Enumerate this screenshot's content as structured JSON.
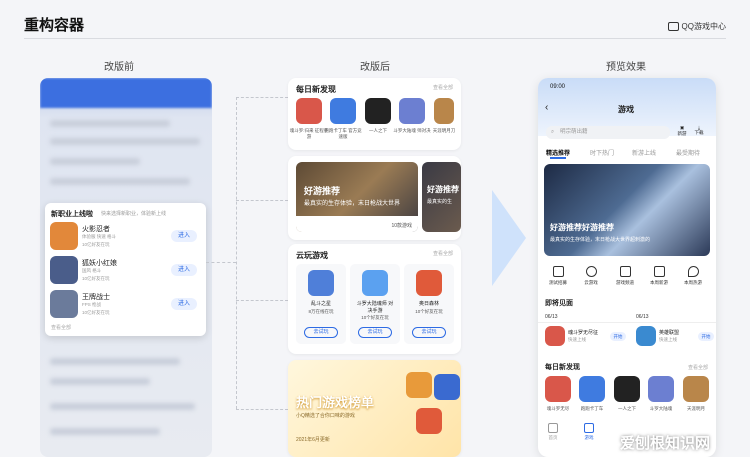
{
  "header": {
    "title": "重构容器",
    "brand": "QQ游戏中心"
  },
  "sections": {
    "before": "改版前",
    "after": "改版后",
    "preview": "预览效果"
  },
  "before_card": {
    "title": "新职业上线啦",
    "subtitle": "快来选择新职业，体验新上线",
    "items": [
      {
        "name": "火影忍者",
        "meta": "体验服 快速 格斗",
        "meta2": "10亿好友在玩",
        "action": "进入",
        "color": "#e2883a"
      },
      {
        "name": "狐妖小红娘",
        "meta": "国风 格斗",
        "meta2": "10亿好友在玩",
        "action": "进入",
        "color": "#4a5d8a"
      },
      {
        "name": "王牌战士",
        "meta": "FPS 枪战",
        "meta2": "10亿好友在玩",
        "action": "进入",
        "color": "#6b7b9b"
      }
    ],
    "more": "查看全部"
  },
  "daily": {
    "title": "每日新发现",
    "more": "查看全部",
    "games": [
      {
        "label": "魂斗罗:归来 征程手游",
        "color": "#d9574a"
      },
      {
        "label": "跑跑卡丁车 官方竞速版",
        "color": "#3f7be0"
      },
      {
        "label": "一人之下",
        "color": "#222"
      },
      {
        "label": "斗罗大陆魂 师对决",
        "color": "#6c7fd1"
      },
      {
        "label": "天涯明月刀",
        "color": "#b9864a"
      }
    ]
  },
  "banner": {
    "title": "好游推荐",
    "subtitle": "最真实的生存体验，末日枪战大世界",
    "count": "10款游戏",
    "title2": "好游推荐",
    "sub2": "最真实的生"
  },
  "cloud": {
    "title": "云玩游戏",
    "more": "查看全部",
    "games": [
      {
        "name": "乱斗之星",
        "players": "8万在线在玩",
        "action": "去试玩",
        "color": "#4f7fd9"
      },
      {
        "name": "斗罗大陆魂师 对决手游",
        "players": "10个好友在玩",
        "action": "去试玩",
        "color": "#5ba1f0"
      },
      {
        "name": "奥日森林",
        "players": "10个好友在玩",
        "action": "去试玩",
        "color": "#e05a3a"
      }
    ]
  },
  "rank": {
    "title": "热门游戏榜单",
    "subtitle": "小Q精选了合你口味的游戏",
    "date": "2021年6月更新"
  },
  "phone": {
    "time": "09:00",
    "header": "游戏",
    "search_placeholder": "明宗萌出籍",
    "gift": "新游",
    "download": "下载",
    "tabs": [
      "精选推荐",
      "时下热门",
      "新游上线",
      "最受期待"
    ],
    "banner_title": "好游推荐好游推荐",
    "banner_sub": "最真实的生存体验，末日枪战大世界超刺激的",
    "quick": [
      "测试招募",
      "云游戏",
      "游戏频道",
      "本周新游",
      "本周热游"
    ],
    "upcoming": {
      "title": "即将见面",
      "items": [
        {
          "date": "06/13",
          "name": "魂斗罗无尽征",
          "meta": "快速上线",
          "action": "开始"
        },
        {
          "date": "06/13",
          "name": "英雄联盟",
          "meta": "快速上线",
          "action": "开始"
        }
      ]
    },
    "daily_title": "每日新发现",
    "daily_more": "查看全部",
    "daily": [
      "魂斗罗无尽",
      "跑跑卡丁车",
      "一人之下",
      "斗罗大陆魂",
      "天涯明月"
    ],
    "nav": [
      "首页",
      "游戏"
    ],
    "watermark": "爱刨根知识网"
  }
}
